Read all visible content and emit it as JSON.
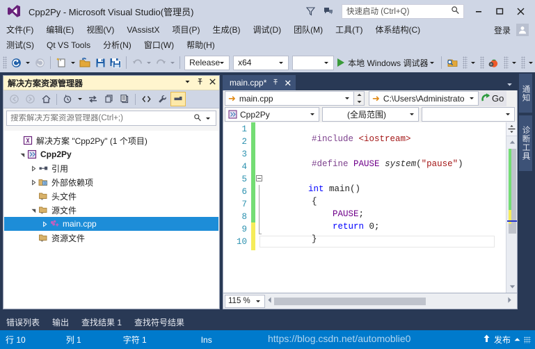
{
  "titlebar": {
    "title": "Cpp2Py - Microsoft Visual Studio(管理员)",
    "logo_icon": "visual-studio-logo",
    "feedback_icon": "feedback-icon",
    "notify_icon": "notifications-icon",
    "quick_launch_placeholder": "快速启动 (Ctrl+Q)",
    "search_icon": "search-icon",
    "minimize_label": "—",
    "maximize_label": "□",
    "close_label": "✕"
  },
  "menus": {
    "row1": [
      {
        "label": "文件(F)",
        "key": "F"
      },
      {
        "label": "编辑(E)",
        "key": "E"
      },
      {
        "label": "视图(V)",
        "key": "V"
      },
      {
        "label": "VAssistX",
        "key": "X"
      },
      {
        "label": "项目(P)",
        "key": "P"
      },
      {
        "label": "生成(B)",
        "key": "B"
      },
      {
        "label": "调试(D)",
        "key": "D"
      },
      {
        "label": "团队(M)",
        "key": "M"
      },
      {
        "label": "工具(T)",
        "key": "T"
      },
      {
        "label": "体系结构(C)",
        "key": "C"
      }
    ],
    "row2": [
      {
        "label": "测试(S)",
        "key": "S"
      },
      {
        "label": "Qt VS Tools",
        "key": ""
      },
      {
        "label": "分析(N)",
        "key": "N"
      },
      {
        "label": "窗口(W)",
        "key": "W"
      },
      {
        "label": "帮助(H)",
        "key": "H"
      }
    ],
    "login_label": "登录",
    "avatar_icon": "user-avatar-icon"
  },
  "toolbar": {
    "nav_back_icon": "navigate-back-icon",
    "nav_forward_icon": "navigate-forward-icon",
    "new_item_icon": "new-item-icon",
    "open_file_icon": "open-file-icon",
    "save_icon": "save-icon",
    "save_all_icon": "save-all-icon",
    "undo_icon": "undo-icon",
    "redo_icon": "redo-icon",
    "configuration": "Release",
    "platform": "x64",
    "run_label": "本地 Windows 调试器",
    "play_icon": "play-icon",
    "find_window_icon": "find-in-window-icon",
    "tomato_icon": "tomato-timer-icon"
  },
  "solution_explorer": {
    "title": "解决方案资源管理器",
    "dropdown_icon": "chevron-down-icon",
    "pin_icon": "pin-icon",
    "close_icon": "close-icon",
    "tools": [
      {
        "name": "back-icon"
      },
      {
        "name": "forward-icon"
      },
      {
        "name": "home-icon"
      },
      {
        "name": "pending-changes-icon"
      },
      {
        "name": "sync-with-active-document-icon"
      },
      {
        "name": "refresh-icon"
      },
      {
        "name": "collapse-all-icon"
      },
      {
        "name": "show-all-files-icon"
      },
      {
        "name": "properties-icon"
      },
      {
        "name": "preview-selected-items-icon"
      }
    ],
    "search_placeholder": "搜索解决方案资源管理器(Ctrl+;)",
    "search_value": "",
    "search_icon": "search-icon",
    "tree": [
      {
        "label": "解决方案 \"Cpp2Py\" (1 个项目)",
        "indent": 0,
        "expander": "none",
        "icon": "solution-icon",
        "bold": false,
        "selected": false
      },
      {
        "label": "Cpp2Py",
        "indent": 1,
        "expander": "expanded",
        "icon": "cpp-project-icon",
        "bold": true,
        "selected": false
      },
      {
        "label": "引用",
        "indent": 2,
        "expander": "collapsed",
        "icon": "references-icon",
        "bold": false,
        "selected": false
      },
      {
        "label": "外部依赖项",
        "indent": 2,
        "expander": "collapsed",
        "icon": "folder-ext-icon",
        "bold": false,
        "selected": false
      },
      {
        "label": "头文件",
        "indent": 2,
        "expander": "none",
        "icon": "filter-folder-icon",
        "bold": false,
        "selected": false
      },
      {
        "label": "源文件",
        "indent": 2,
        "expander": "expanded",
        "icon": "filter-folder-icon",
        "bold": false,
        "selected": false
      },
      {
        "label": "main.cpp",
        "indent": 3,
        "expander": "collapsed",
        "icon": "cpp-file-icon",
        "bold": false,
        "selected": true
      },
      {
        "label": "资源文件",
        "indent": 2,
        "expander": "none",
        "icon": "filter-folder-icon",
        "bold": false,
        "selected": false
      }
    ]
  },
  "editor": {
    "tab_label": "main.cpp*",
    "tab_pin_icon": "pin-icon",
    "tab_close_icon": "close-icon",
    "tabstrip_chevron_icon": "chevron-down-icon",
    "nav_file": "main.cpp",
    "nav_path": "C:\\Users\\Administrato",
    "go_label": "Go",
    "go_icon": "go-arrow-icon",
    "project_scope": "Cpp2Py",
    "project_icon": "cpp-project-icon",
    "member_scope": "(全局范围)",
    "third_scope": "",
    "line_numbers": [
      "1",
      "2",
      "3",
      "4",
      "5",
      "6",
      "7",
      "8",
      "9",
      "10"
    ],
    "code_lines": [
      {
        "n": 1,
        "tokens": [
          {
            "t": "#include",
            "c": "pp"
          },
          {
            "t": " ",
            "c": "pun"
          },
          {
            "t": "<iostream>",
            "c": "str"
          }
        ]
      },
      {
        "n": 2,
        "tokens": []
      },
      {
        "n": 3,
        "tokens": [
          {
            "t": "#define",
            "c": "pp"
          },
          {
            "t": " ",
            "c": "pun"
          },
          {
            "t": "PAUSE",
            "c": "mac"
          },
          {
            "t": " ",
            "c": "pun"
          },
          {
            "t": "system",
            "c": "it"
          },
          {
            "t": "(",
            "c": "pun"
          },
          {
            "t": "\"pause\"",
            "c": "str"
          },
          {
            "t": ")",
            "c": "pun"
          }
        ]
      },
      {
        "n": 4,
        "tokens": []
      },
      {
        "n": 5,
        "tokens": [
          {
            "t": "int",
            "c": "kw"
          },
          {
            "t": " main()",
            "c": "pun"
          }
        ]
      },
      {
        "n": 6,
        "tokens": [
          {
            "t": "{",
            "c": "pun"
          }
        ]
      },
      {
        "n": 7,
        "tokens": [
          {
            "t": "    ",
            "c": "pun"
          },
          {
            "t": "PAUSE",
            "c": "mac"
          },
          {
            "t": ";",
            "c": "pun"
          }
        ]
      },
      {
        "n": 8,
        "tokens": [
          {
            "t": "    ",
            "c": "pun"
          },
          {
            "t": "return",
            "c": "kw"
          },
          {
            "t": " 0;",
            "c": "pun"
          }
        ]
      },
      {
        "n": 9,
        "tokens": [
          {
            "t": "}",
            "c": "pun"
          }
        ]
      },
      {
        "n": 10,
        "tokens": []
      }
    ],
    "zoom_level": "115 %",
    "split_icon": "split-view-icon",
    "scroll_up_icon": "scroll-up-icon",
    "scroll_down_icon": "scroll-down-icon",
    "colors": {
      "unsaved_marker": "#f5ec5a",
      "saved_marker": "#74dd74",
      "keyword": "#0000ff",
      "preprocessor": "#7c3f8c",
      "string": "#a31515",
      "macro": "#6f008a",
      "line_number": "#2b91af"
    }
  },
  "right_tabs": [
    {
      "label": "通知"
    },
    {
      "label": "诊断工具"
    }
  ],
  "dock_tabs": [
    {
      "label": "错误列表"
    },
    {
      "label": "输出"
    },
    {
      "label": "查找结果 1"
    },
    {
      "label": "查找符号结果"
    }
  ],
  "status": {
    "line": "行 10",
    "column": "列 1",
    "character": "字符 1",
    "insert_mode": "Ins",
    "publish_label": "发布",
    "publish_icon": "publish-up-arrow-icon",
    "accent_color": "#007acc"
  },
  "watermark": {
    "text": "https://blog.csdn.net/automoblie0"
  }
}
